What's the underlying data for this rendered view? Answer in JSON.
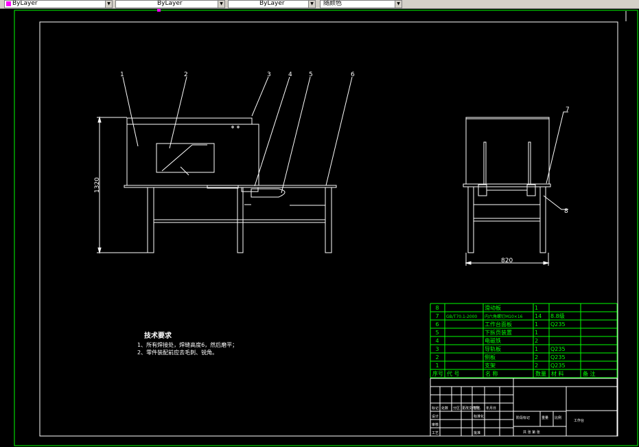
{
  "toolbar": {
    "combos": [
      {
        "value": "ByLayer",
        "swatch": "#ff00ff"
      },
      {
        "value": "ByLayer"
      },
      {
        "value": "ByLayer"
      },
      {
        "value": "随颜色"
      }
    ]
  },
  "colors": {
    "background": "#000000",
    "line": "#ffffff",
    "bom": "#00ff00",
    "border_frame": "#00ff00"
  },
  "front_view": {
    "leaders": [
      "1",
      "2",
      "3",
      "4",
      "5",
      "6"
    ],
    "height_dim": "1320"
  },
  "side_view": {
    "leaders": [
      "7",
      "8"
    ],
    "width_dim": "820"
  },
  "tech_requirements": {
    "title": "技术要求",
    "line1": "1、所有焊接处，焊缝高度6，然后磨平；",
    "line2": "2、零件装配前应去毛刺、锐角。"
  },
  "bom": {
    "rows": [
      {
        "no": "8",
        "code": "",
        "name": "滑动板",
        "qty": "1",
        "material": "",
        "note": ""
      },
      {
        "no": "7",
        "code": "GB/T70.1-2000",
        "name": "内六角螺钉M10×16",
        "qty": "14",
        "material": "8.8级",
        "note": ""
      },
      {
        "no": "6",
        "code": "",
        "name": "工作台面板",
        "qty": "1",
        "material": "Q235",
        "note": ""
      },
      {
        "no": "5",
        "code": "",
        "name": "下拆页装置",
        "qty": "1",
        "material": "",
        "note": ""
      },
      {
        "no": "4",
        "code": "",
        "name": "电磁铁",
        "qty": "2",
        "material": "",
        "note": ""
      },
      {
        "no": "3",
        "code": "",
        "name": "导轨板",
        "qty": "1",
        "material": "Q235",
        "note": ""
      },
      {
        "no": "2",
        "code": "",
        "name": "侧板",
        "qty": "2",
        "material": "Q235",
        "note": ""
      },
      {
        "no": "1",
        "code": "",
        "name": "支架",
        "qty": "2",
        "material": "Q235",
        "note": ""
      }
    ],
    "header": {
      "no": "序号",
      "code": "代 号",
      "name": "名 称",
      "qty": "数量",
      "material": "材 料",
      "note": "备 注"
    }
  },
  "title_block": {
    "labels": {
      "mark": "标记",
      "count": "处数",
      "zone": "分区",
      "change_doc": "更改文件号",
      "sign": "签名",
      "date": "年月日",
      "design": "设计",
      "standardize": "标准化",
      "review": "审核",
      "process": "工艺",
      "approve": "批准",
      "stage": "阶段标记",
      "weight": "重量",
      "scale": "比例",
      "sheets": "共 张 第 张",
      "drawing_name": "工作台"
    }
  }
}
